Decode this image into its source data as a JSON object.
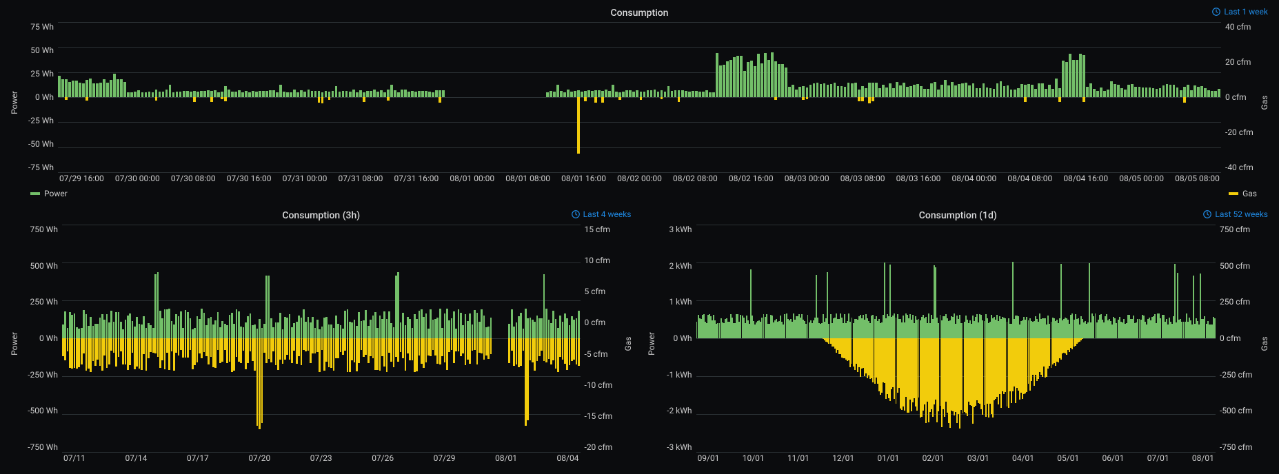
{
  "colors": {
    "power": "#73bf69",
    "gas": "#f2cc0c",
    "link": "#1f8be6",
    "grid": "#2c3235"
  },
  "legend": {
    "power": "Power",
    "gas": "Gas"
  },
  "axis_labels": {
    "left": "Power",
    "right": "Gas"
  },
  "panel1": {
    "title": "Consumption",
    "time_range": "Last 1 week",
    "y_left_ticks": [
      "75 Wh",
      "50 Wh",
      "25 Wh",
      "0 Wh",
      "-25 Wh",
      "-50 Wh",
      "-75 Wh"
    ],
    "y_right_ticks": [
      "40 cfm",
      "20 cfm",
      "0 cfm",
      "-20 cfm",
      "-40 cfm"
    ],
    "x_ticks": [
      "07/29 16:00",
      "07/30 00:00",
      "07/30 08:00",
      "07/30 16:00",
      "07/31 00:00",
      "07/31 08:00",
      "07/31 16:00",
      "08/01 00:00",
      "08/01 08:00",
      "08/01 16:00",
      "08/02 00:00",
      "08/02 08:00",
      "08/02 16:00",
      "08/03 00:00",
      "08/03 08:00",
      "08/03 16:00",
      "08/04 00:00",
      "08/04 08:00",
      "08/04 16:00",
      "08/05 00:00",
      "08/05 08:00"
    ]
  },
  "panel2": {
    "title": "Consumption (3h)",
    "time_range": "Last 4 weeks",
    "y_left_ticks": [
      "750 Wh",
      "500 Wh",
      "250 Wh",
      "0 Wh",
      "-250 Wh",
      "-500 Wh",
      "-750 Wh"
    ],
    "y_right_ticks": [
      "15 cfm",
      "10 cfm",
      "5 cfm",
      "0 cfm",
      "-5 cfm",
      "-10 cfm",
      "-15 cfm",
      "-20 cfm"
    ],
    "x_ticks": [
      "07/11",
      "07/14",
      "07/17",
      "07/20",
      "07/23",
      "07/26",
      "07/29",
      "08/01",
      "08/04"
    ]
  },
  "panel3": {
    "title": "Consumption (1d)",
    "time_range": "Last 52 weeks",
    "y_left_ticks": [
      "3 kWh",
      "2 kWh",
      "1 kWh",
      "0 Wh",
      "-1 kWh",
      "-2 kWh",
      "-3 kWh"
    ],
    "y_right_ticks": [
      "750 cfm",
      "500 cfm",
      "250 cfm",
      "0 cfm",
      "-250 cfm",
      "-500 cfm",
      "-750 cfm"
    ],
    "x_ticks": [
      "09/01",
      "10/01",
      "11/01",
      "12/01",
      "01/01",
      "02/01",
      "03/01",
      "04/01",
      "05/01",
      "06/01",
      "07/01",
      "08/01"
    ]
  },
  "chart_data": [
    {
      "id": "consumption-1w",
      "type": "bar",
      "title": "Consumption",
      "xlabel": "",
      "x_type": "time",
      "x_range": [
        "2023-07-29T16:00",
        "2023-08-05T12:00"
      ],
      "series": [
        {
          "name": "Power",
          "axis": "left",
          "ylabel": "Power",
          "unit": "Wh",
          "ylim": [
            -75,
            75
          ]
        },
        {
          "name": "Gas",
          "axis": "right",
          "ylabel": "Gas",
          "unit": "cfm",
          "ylim": [
            -40,
            40
          ]
        }
      ],
      "notes": "Half-hourly bars. Power positive (green). Gas drawn negative (yellow). Jul 29 evening ~20 Wh, tapering. Jul 30–31 baseline 5–10 Wh with sparse 1–2 cfm gas. Aug 1 ~00:00–14:00 gap (no data). Aug 1 ~17:00 isolated gas spike ≈ -30 cfm. Aug 2 afternoon cluster of power peaks 40–45 Wh. Aug 3–5 steady 5–15 Wh with periodic ~15 Wh bumps; gas bursts 1–3 cfm. Aug 4 ~17:00 power peak ≈ 45 Wh."
    },
    {
      "id": "consumption-3h-4w",
      "type": "bar",
      "title": "Consumption (3h)",
      "xlabel": "",
      "x_type": "time",
      "x_range": [
        "2023-07-08",
        "2023-08-05"
      ],
      "series": [
        {
          "name": "Power",
          "axis": "left",
          "ylabel": "Power",
          "unit": "Wh",
          "ylim": [
            -750,
            750
          ]
        },
        {
          "name": "Gas",
          "axis": "right",
          "ylabel": "Gas",
          "unit": "cfm",
          "ylim": [
            -20,
            15
          ]
        }
      ],
      "notes": "3-hour bins over 4 weeks. Power 50–300 Wh most bins; a handful reach ~450 Wh (around 07/13, 07/19, 07/26). Gas negative bars -2 to -8 cfm most bins; largest dips ≈ -15 cfm near 07/18–07/19 and 08/02–08/03. One-day gap around 07/31–08/01."
    },
    {
      "id": "consumption-1d-52w",
      "type": "bar",
      "title": "Consumption (1d)",
      "xlabel": "",
      "x_type": "time",
      "x_range": [
        "2022-08-05",
        "2023-08-05"
      ],
      "series": [
        {
          "name": "Power",
          "axis": "left",
          "ylabel": "Power",
          "unit": "kWh",
          "ylim": [
            -3,
            3
          ]
        },
        {
          "name": "Gas",
          "axis": "right",
          "ylabel": "Gas",
          "unit": "cfm",
          "ylim": [
            -750,
            750
          ]
        }
      ],
      "notes": "Daily bars over 52 weeks. Power ~0.3–0.8 kWh/day year-round with occasional 1.5–2 kWh spikes. Gas near 0 in Aug–Sep, ramps through autumn, heavy Nov–Mar band roughly -300 to -550 cfm with deepest days around -600 cfm in Jan–Feb, tapers Apr–May, near-zero Jun–Aug."
    }
  ]
}
